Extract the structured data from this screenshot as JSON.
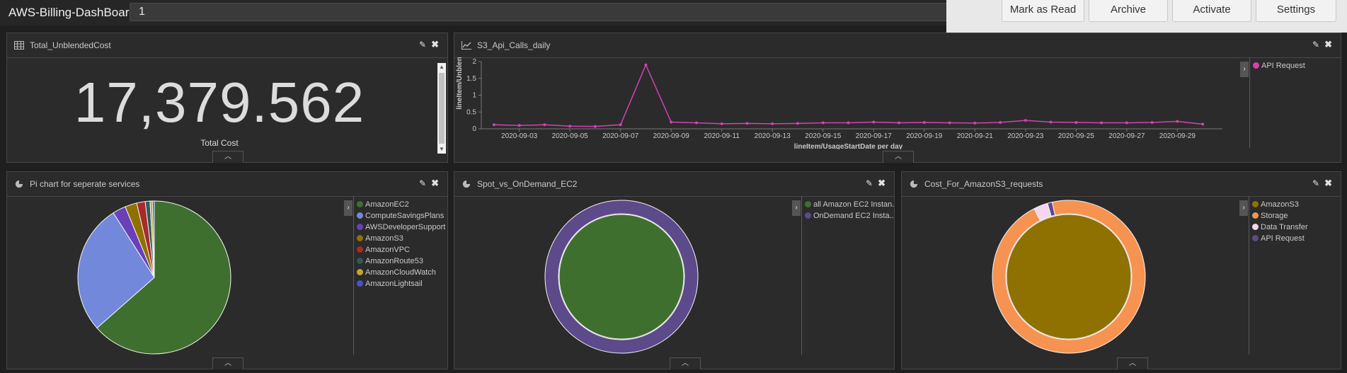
{
  "app": {
    "title": "AWS-Billing-DashBoard",
    "name_value": "1"
  },
  "actions": [
    "Mark as Read",
    "Archive",
    "Activate",
    "Settings"
  ],
  "panels": {
    "total": {
      "title": "Total_UnblendedCost",
      "value": "17,379.562",
      "label": "Total Cost"
    },
    "s3api": {
      "title": "S3_Api_Calls_daily",
      "legend": [
        "API Request"
      ]
    },
    "pie": {
      "title": "Pi chart for seperate services",
      "legend": [
        "AmazonEC2",
        "ComputeSavingsPlans",
        "AWSDeveloperSupport",
        "AmazonS3",
        "AmazonVPC",
        "AmazonRoute53",
        "AmazonCloudWatch",
        "AmazonLightsail"
      ]
    },
    "spot": {
      "title": "Spot_vs_OnDemand_EC2",
      "legend": [
        "all Amazon EC2 Instan...",
        "OnDemand EC2 Insta..."
      ]
    },
    "s3cost": {
      "title": "Cost_For_AmazonS3_requests",
      "legend": [
        "AmazonS3",
        "Storage",
        "Data Transfer",
        "API Request"
      ]
    }
  },
  "icons": {
    "edit": "pencil-icon",
    "close": "close-icon",
    "collapse": "chevron-up-icon",
    "legend_toggle": "chevron-right-icon"
  },
  "colors": {
    "magenta": "#d63fb4",
    "ec2_green": "#3f6f2f",
    "periwinkle": "#7288db",
    "purple": "#5c4a8a",
    "olive": "#8e7100",
    "orange": "#f69351"
  },
  "chart_data": [
    {
      "type": "line",
      "title": "S3_Api_Calls_daily",
      "xlabel": "lineItem/UsageStartDate per day",
      "ylabel": "lineItem/Unblend",
      "ylim": [
        0,
        2
      ],
      "yticks": [
        "0",
        "0.5",
        "1",
        "1.5",
        "2"
      ],
      "x": [
        "2020-09-02",
        "2020-09-03",
        "2020-09-04",
        "2020-09-05",
        "2020-09-06",
        "2020-09-07",
        "2020-09-08",
        "2020-09-09",
        "2020-09-10",
        "2020-09-11",
        "2020-09-12",
        "2020-09-13",
        "2020-09-14",
        "2020-09-15",
        "2020-09-16",
        "2020-09-17",
        "2020-09-18",
        "2020-09-19",
        "2020-09-20",
        "2020-09-21",
        "2020-09-22",
        "2020-09-23",
        "2020-09-24",
        "2020-09-25",
        "2020-09-26",
        "2020-09-27",
        "2020-09-28",
        "2020-09-29",
        "2020-09-30"
      ],
      "xticks": [
        "2020-09-03",
        "2020-09-05",
        "2020-09-07",
        "2020-09-09",
        "2020-09-11",
        "2020-09-13",
        "2020-09-15",
        "2020-09-17",
        "2020-09-19",
        "2020-09-21",
        "2020-09-23",
        "2020-09-25",
        "2020-09-27",
        "2020-09-29"
      ],
      "series": [
        {
          "name": "API Request",
          "color": "#d63fb4",
          "values": [
            0.12,
            0.1,
            0.12,
            0.08,
            0.07,
            0.12,
            1.9,
            0.2,
            0.18,
            0.15,
            0.16,
            0.15,
            0.16,
            0.18,
            0.18,
            0.2,
            0.18,
            0.19,
            0.18,
            0.17,
            0.19,
            0.25,
            0.2,
            0.19,
            0.18,
            0.18,
            0.19,
            0.22,
            0.14
          ]
        }
      ],
      "grid": false,
      "legend": "right"
    },
    {
      "type": "pie",
      "title": "Pi chart for seperate services",
      "labels": [
        "AmazonEC2",
        "ComputeSavingsPlans",
        "AWSDeveloperSupport",
        "AmazonS3",
        "AmazonVPC",
        "AmazonRoute53",
        "AmazonCloudWatch",
        "AmazonLightsail"
      ],
      "values": [
        63.5,
        27.5,
        2.8,
        2.5,
        1.8,
        1.0,
        0.5,
        0.4
      ],
      "colors": [
        "#3f6f2f",
        "#7288db",
        "#6a3fb8",
        "#8e7100",
        "#a82a2a",
        "#2e5a5a",
        "#c6a42a",
        "#4a4fd0"
      ],
      "legend": "right"
    },
    {
      "type": "pie",
      "donut": true,
      "title": "Spot_vs_OnDemand_EC2",
      "labels": [
        "all Amazon EC2 Instan...",
        "OnDemand EC2 Insta..."
      ],
      "inner": {
        "label": "all Amazon EC2 Instan...",
        "value": 100,
        "color": "#3f6f2f"
      },
      "outer": [
        {
          "label": "OnDemand EC2 Insta...",
          "value": 100,
          "color": "#5c4a8a"
        }
      ],
      "legend": "right"
    },
    {
      "type": "pie",
      "donut": true,
      "title": "Cost_For_AmazonS3_requests",
      "labels": [
        "AmazonS3",
        "Storage",
        "Data Transfer",
        "API Request"
      ],
      "inner": {
        "label": "AmazonS3",
        "value": 100,
        "color": "#8e7100"
      },
      "outer": [
        {
          "label": "Storage",
          "value": 96,
          "color": "#f69351"
        },
        {
          "label": "Data Transfer",
          "value": 3,
          "color": "#f4d6f0"
        },
        {
          "label": "API Request",
          "value": 1,
          "color": "#5c4a8a"
        }
      ],
      "legend": "right"
    }
  ]
}
